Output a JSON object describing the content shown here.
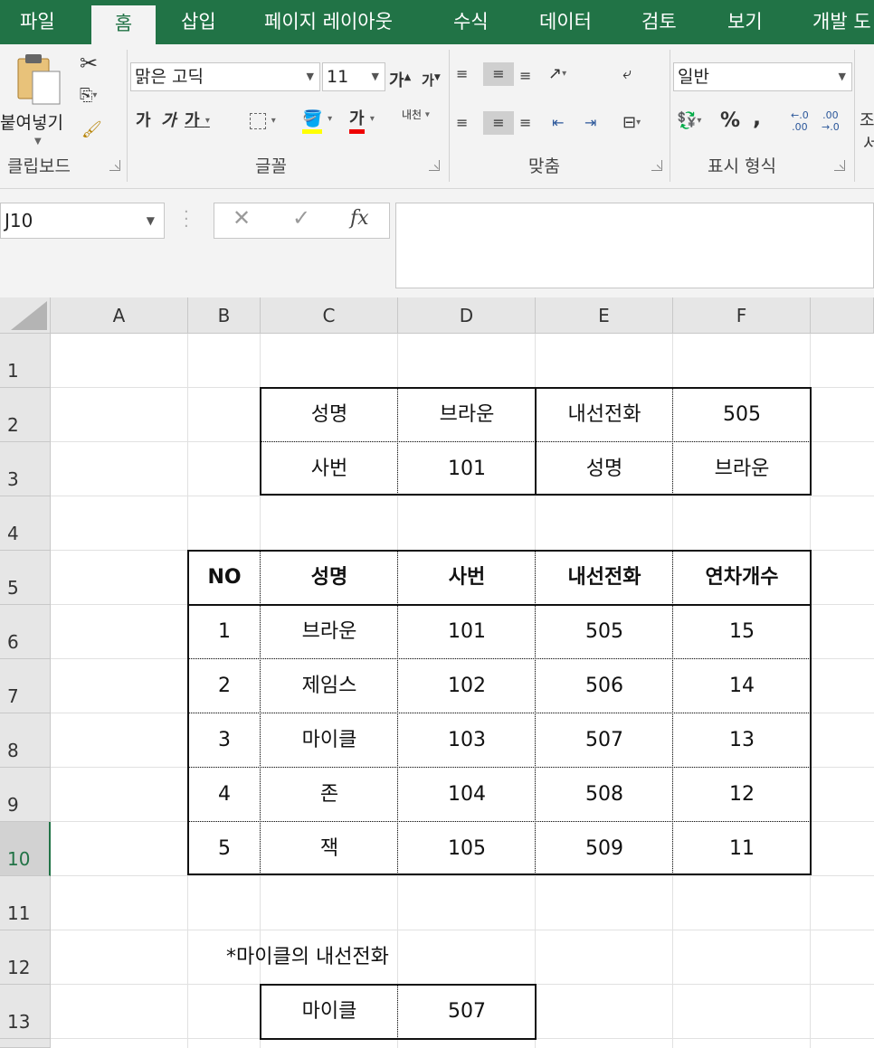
{
  "tabs": [
    "파일",
    "홈",
    "삽입",
    "페이지 레이아웃",
    "수식",
    "데이터",
    "검토",
    "보기",
    "개발 도"
  ],
  "ribbon": {
    "clipboard": {
      "paste_label": "붙여넣기",
      "group_label": "클립보드"
    },
    "font": {
      "font_name": "맑은 고딕",
      "font_size": "11",
      "grow": "가",
      "shrink": "가",
      "bold": "가",
      "italic": "가",
      "underline": "가",
      "font_color_glyph": "가",
      "phonetic": "내천",
      "group_label": "글꼴"
    },
    "alignment": {
      "group_label": "맞춤"
    },
    "number": {
      "format": "일반",
      "percent": "%",
      "comma": ",",
      "group_label": "표시 형식"
    },
    "styles": {
      "cut_text": "조",
      "cut_text2": "서"
    }
  },
  "formula_bar": {
    "name_box": "J10",
    "fx": "fx",
    "cancel": "✕",
    "confirm": "✓",
    "value": ""
  },
  "columns": [
    "A",
    "B",
    "C",
    "D",
    "E",
    "F"
  ],
  "rows": [
    "1",
    "2",
    "3",
    "4",
    "5",
    "6",
    "7",
    "8",
    "9",
    "10",
    "11",
    "12",
    "13"
  ],
  "lookup_table": {
    "r2": [
      "성명",
      "브라운",
      "내선전화",
      "505"
    ],
    "r3": [
      "사번",
      "101",
      "성명",
      "브라운"
    ]
  },
  "main_table": {
    "headers": [
      "NO",
      "성명",
      "사번",
      "내선전화",
      "연차개수"
    ],
    "rows": [
      [
        "1",
        "브라운",
        "101",
        "505",
        "15"
      ],
      [
        "2",
        "제임스",
        "102",
        "506",
        "14"
      ],
      [
        "3",
        "마이클",
        "103",
        "507",
        "13"
      ],
      [
        "4",
        "존",
        "104",
        "508",
        "12"
      ],
      [
        "5",
        "잭",
        "105",
        "509",
        "11"
      ]
    ]
  },
  "note": "*마이클의 내선전화",
  "result": [
    "마이클",
    "507"
  ],
  "colors": {
    "accent": "#217346",
    "ribbon_bg": "#f3f3f3",
    "header_bg": "#e6e6e6"
  }
}
